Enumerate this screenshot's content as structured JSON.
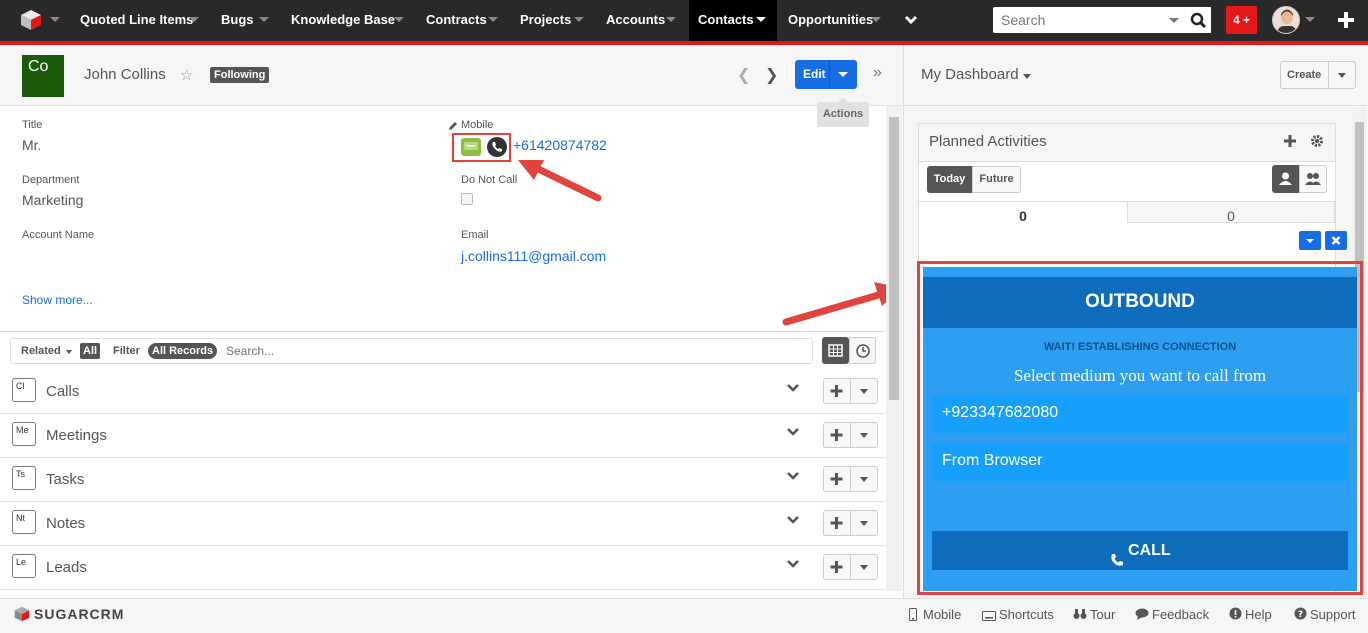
{
  "nav": {
    "items": [
      {
        "label": "Quoted Line Items"
      },
      {
        "label": "Bugs"
      },
      {
        "label": "Knowledge Base"
      },
      {
        "label": "Contracts"
      },
      {
        "label": "Projects"
      },
      {
        "label": "Accounts"
      },
      {
        "label": "Contacts"
      },
      {
        "label": "Opportunities"
      }
    ],
    "search_placeholder": "Search",
    "notifications": "4 +",
    "accent_color": "#e61718"
  },
  "record": {
    "avatar": "Co",
    "name": "John Collins",
    "following": "Following",
    "edit_label": "Edit",
    "actions_tip": "Actions",
    "fields": {
      "title_label": "Title",
      "title_value": "Mr.",
      "department_label": "Department",
      "department_value": "Marketing",
      "account_label": "Account Name",
      "mobile_label": "Mobile",
      "mobile_value": "+61420874782",
      "dnc_label": "Do Not Call",
      "email_label": "Email",
      "email_value": "j.collins111@gmail.com"
    },
    "show_more": "Show more..."
  },
  "subpanels": {
    "related_label": "Related",
    "related_value": "All",
    "filter_label": "Filter",
    "filter_value": "All Records",
    "search_placeholder": "Search...",
    "rows": [
      {
        "icon": "Cl",
        "label": "Calls"
      },
      {
        "icon": "Me",
        "label": "Meetings"
      },
      {
        "icon": "Ts",
        "label": "Tasks"
      },
      {
        "icon": "Nt",
        "label": "Notes"
      },
      {
        "icon": "Le",
        "label": "Leads"
      }
    ]
  },
  "dashboard": {
    "title": "My Dashboard",
    "create_label": "Create",
    "dashlet_title": "Planned Activities",
    "tab_today": "Today",
    "tab_future": "Future",
    "count_left": "0",
    "count_right": "0"
  },
  "outbound": {
    "title": "OUTBOUND",
    "status": "WAIT! ESTABLISHING CONNECTION",
    "prompt": "Select medium you want to call from",
    "options": [
      "+923347682080",
      "From Browser"
    ],
    "call_label": "CALL"
  },
  "footer": {
    "brand": "SUGARCRM",
    "items": [
      "Mobile",
      "Shortcuts",
      "Tour",
      "Feedback",
      "Help",
      "Support"
    ]
  }
}
